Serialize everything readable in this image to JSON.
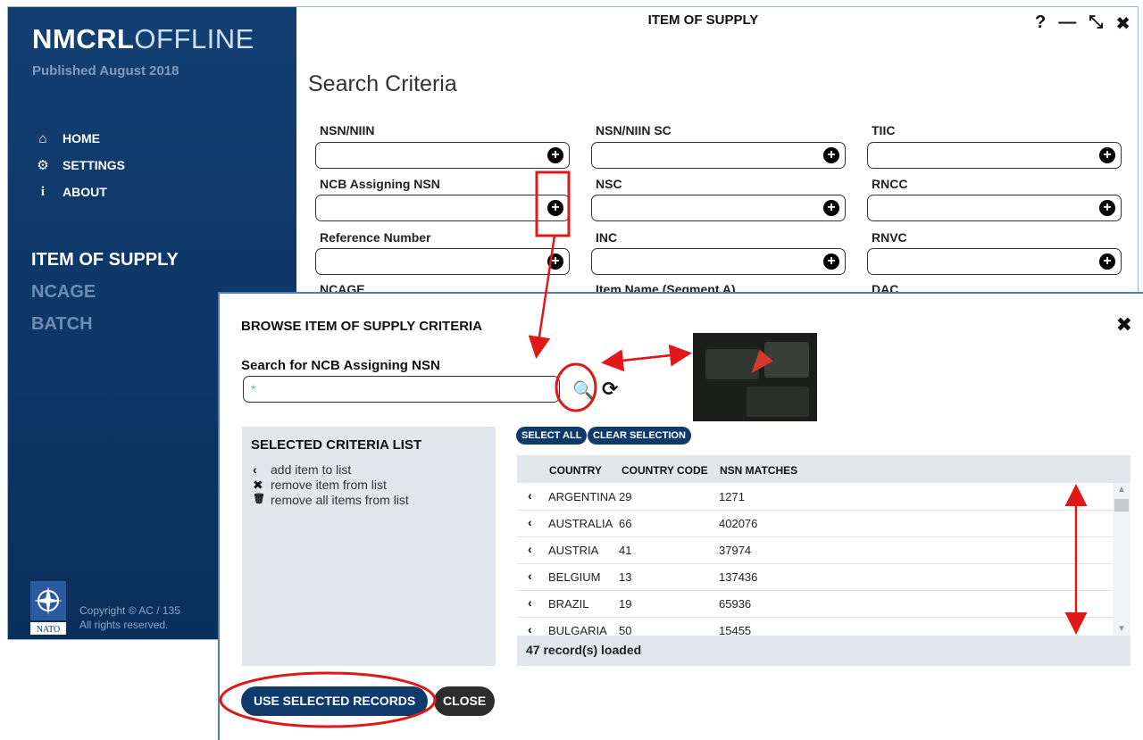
{
  "sidebar": {
    "brand_bold": "NMCRL",
    "brand_light": "OFFLINE",
    "published": "Published August 2018",
    "nav": [
      {
        "label": "HOME",
        "icon": "home-icon"
      },
      {
        "label": "SETTINGS",
        "icon": "gear-icon"
      },
      {
        "label": "ABOUT",
        "icon": "info-icon"
      }
    ],
    "sections": [
      "ITEM OF SUPPLY",
      "NCAGE",
      "BATCH"
    ],
    "nato_label": "NATO",
    "copyright_line1": "Copyright © AC / 135",
    "copyright_line2": "All rights reserved."
  },
  "window": {
    "title": "ITEM OF SUPPLY",
    "controls": [
      "?",
      "—",
      "⤡",
      "✖"
    ],
    "heading": "Search Criteria",
    "fields": [
      {
        "label": "NSN/NIIN"
      },
      {
        "label": "NSN/NIIN SC"
      },
      {
        "label": "TIIC"
      },
      {
        "label": "NCB Assigning NSN"
      },
      {
        "label": "NSC"
      },
      {
        "label": "RNCC"
      },
      {
        "label": "Reference Number"
      },
      {
        "label": "INC"
      },
      {
        "label": "RNVC"
      },
      {
        "label": "NCAGE"
      },
      {
        "label": "Item Name (Segment A)"
      },
      {
        "label": "DAC"
      }
    ]
  },
  "dialog": {
    "title": "BROWSE ITEM OF SUPPLY CRITERIA",
    "search_label": "Search for NCB Assigning NSN",
    "search_value": "*",
    "selected_title": "SELECTED CRITERIA LIST",
    "legend": [
      {
        "icon": "‹",
        "text": "add item to list"
      },
      {
        "icon": "✖",
        "text": "remove item from list"
      },
      {
        "icon": "🗑",
        "text": "remove all items from list"
      }
    ],
    "select_all": "SELECT ALL",
    "clear_selection": "CLEAR SELECTION",
    "columns": [
      "COUNTRY",
      "COUNTRY CODE",
      "NSN MATCHES"
    ],
    "rows": [
      {
        "country": "ARGENTINA",
        "code": "29",
        "matches": "1271"
      },
      {
        "country": "AUSTRALIA",
        "code": "66",
        "matches": "402076"
      },
      {
        "country": "AUSTRIA",
        "code": "41",
        "matches": "37974"
      },
      {
        "country": "BELGIUM",
        "code": "13",
        "matches": "137436"
      },
      {
        "country": "BRAZIL",
        "code": "19",
        "matches": "65936"
      },
      {
        "country": "BULGARIA",
        "code": "50",
        "matches": "15455"
      }
    ],
    "records_loaded": "47 record(s) loaded",
    "use_selected": "USE SELECTED RECORDS",
    "close": "CLOSE"
  },
  "colors": {
    "sidebar": "#0d3565",
    "accent": "#0f3a6b",
    "annotation": "#e01818"
  }
}
